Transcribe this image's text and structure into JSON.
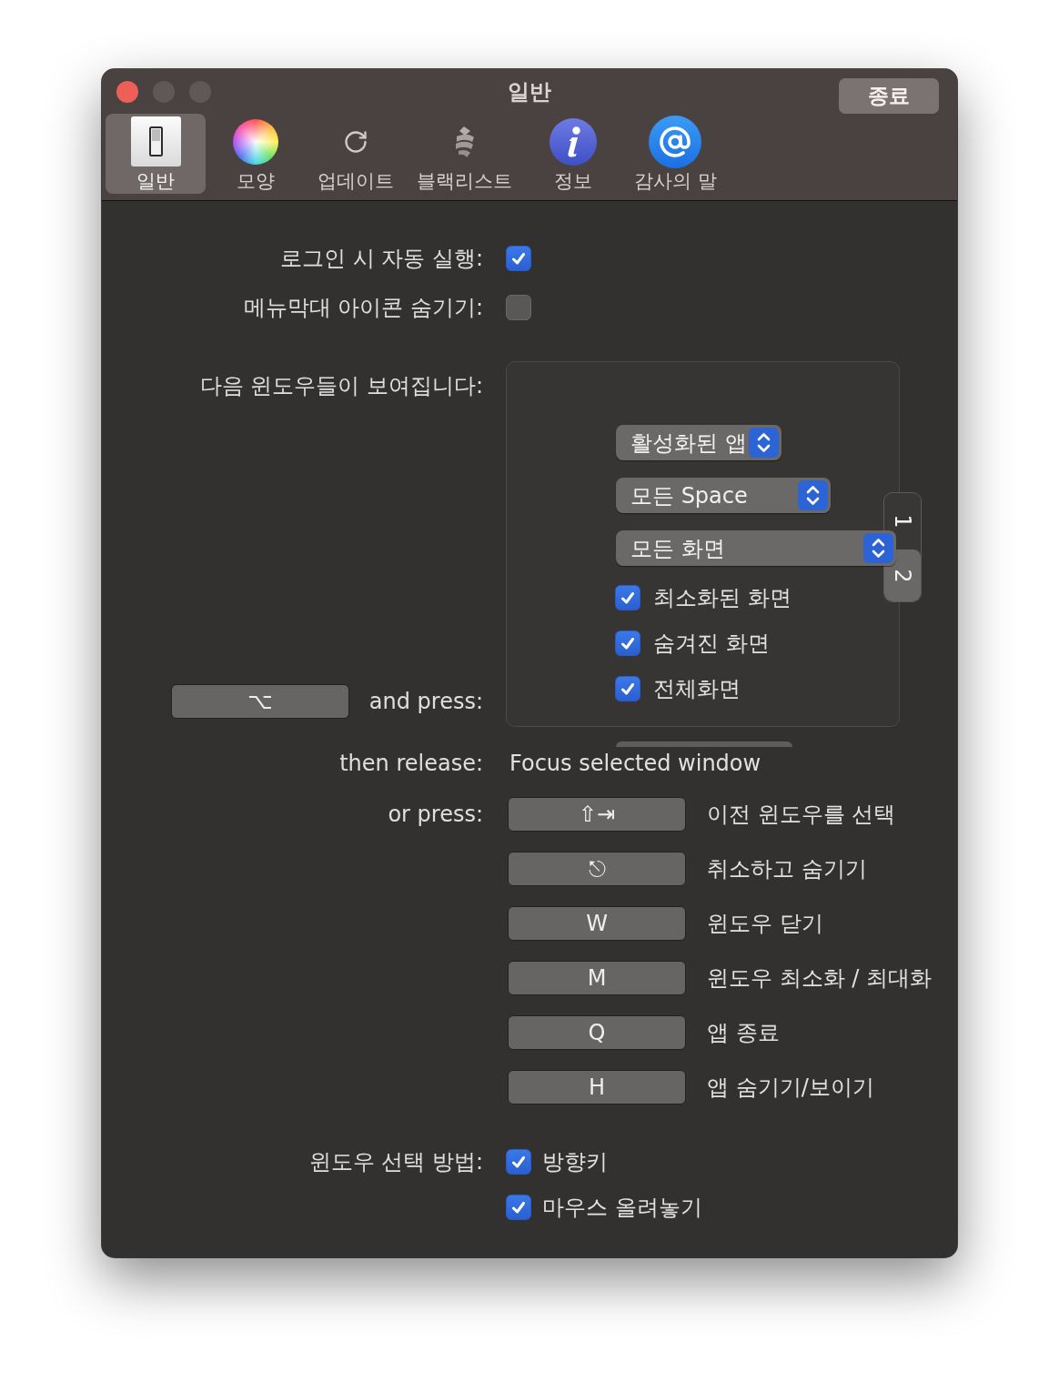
{
  "window": {
    "title": "일반",
    "controls": [
      {
        "kind": "close",
        "disabled": false
      },
      {
        "kind": "minimize",
        "disabled": true
      },
      {
        "kind": "zoom",
        "disabled": true
      }
    ],
    "quit_button": "종료"
  },
  "toolbar": [
    {
      "label": "일반",
      "kind": "switch",
      "selected": true
    },
    {
      "label": "모양",
      "kind": "palette",
      "selected": false
    },
    {
      "label": "업데이트",
      "kind": "update",
      "selected": false
    },
    {
      "label": "블랙리스트",
      "kind": "blacklist",
      "selected": false
    },
    {
      "label": "정보",
      "kind": "info",
      "selected": false
    },
    {
      "label": "감사의 말",
      "kind": "credits",
      "selected": false
    }
  ],
  "settings": {
    "launch_at_login": {
      "label": "로그인 시 자동 실행:",
      "checked": true
    },
    "hide_menubar_icon": {
      "label": "메뉴막대 아이콘 숨기기:",
      "checked": false
    },
    "shown_windows": {
      "label": "다음 윈도우들이 보여집니다:",
      "popups": [
        "활성화된 앱",
        "모든 Space",
        "모든 화면"
      ],
      "options": [
        {
          "label": "최소화된 화면",
          "checked": true
        },
        {
          "label": "숨겨진 화면",
          "checked": true
        },
        {
          "label": "전체화면",
          "checked": true
        }
      ],
      "tabs": [
        {
          "label": "1",
          "selected": false
        },
        {
          "label": "2",
          "selected": true
        }
      ]
    },
    "trigger": {
      "key": "⌥",
      "label": "and press:"
    },
    "release": {
      "label": "then release:",
      "value": "Focus selected window"
    },
    "shortcuts": {
      "label": "or press:",
      "items": [
        {
          "key": "⇧⇥",
          "action": "이전 윈도우를 선택"
        },
        {
          "key": "⎋",
          "action": "취소하고 숨기기"
        },
        {
          "key": "W",
          "action": "윈도우 닫기"
        },
        {
          "key": "M",
          "action": "윈도우 최소화 / 최대화"
        },
        {
          "key": "Q",
          "action": "앱 종료"
        },
        {
          "key": "H",
          "action": "앱 숨기기/보이기"
        }
      ]
    },
    "selection": {
      "label": "윈도우 선택 방법:",
      "options": [
        {
          "label": "방향키",
          "checked": true
        },
        {
          "label": "마우스 올려놓기",
          "checked": true
        }
      ]
    }
  }
}
